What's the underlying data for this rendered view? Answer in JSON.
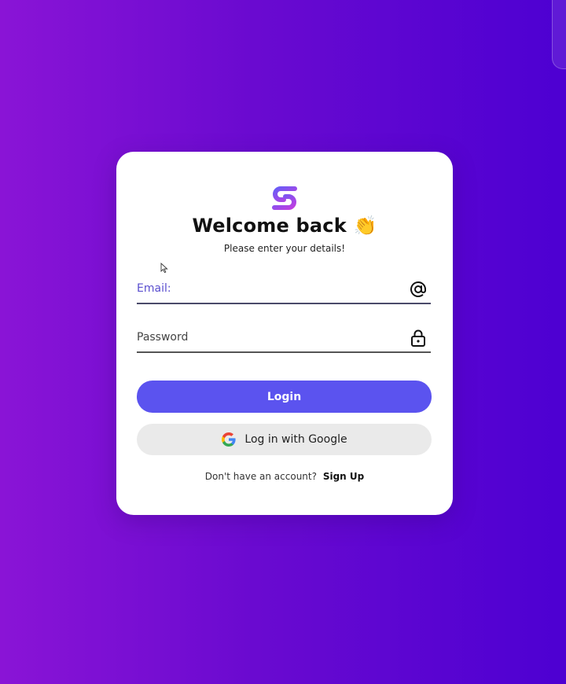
{
  "colors": {
    "background_start": "#8a14d6",
    "background_end": "#4d00d2",
    "card": "#ffffff",
    "primary_button": "#5b53ef",
    "secondary_button": "#eaeaea"
  },
  "header": {
    "logo_icon": "brand-s-logo-icon",
    "title": "Welcome back",
    "title_emoji": "👏",
    "subtitle": "Please enter your details!"
  },
  "form": {
    "email": {
      "label": "Email:",
      "value": "",
      "icon": "at-sign-icon"
    },
    "password": {
      "label": "Password",
      "value": "",
      "icon": "lock-icon"
    }
  },
  "actions": {
    "login_label": "Login",
    "google_label": "Log in with Google",
    "google_icon": "google-icon"
  },
  "footer": {
    "prompt": "Don't have an account?",
    "signup_label": "Sign Up"
  }
}
